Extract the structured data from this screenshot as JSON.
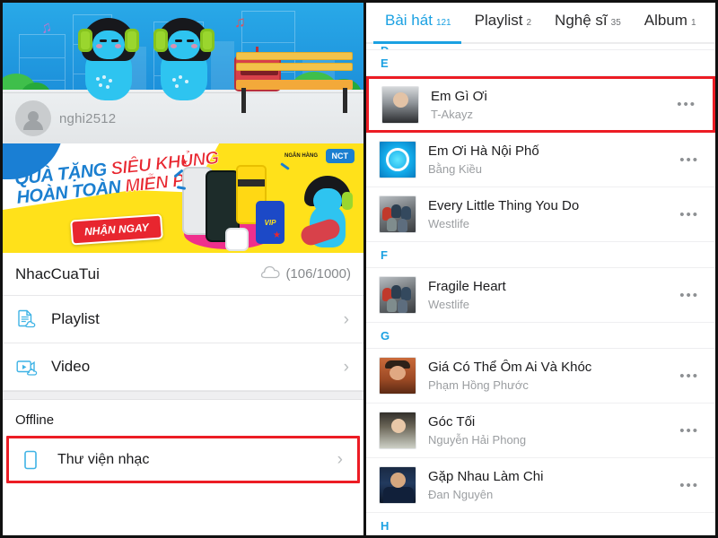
{
  "left": {
    "hero": {
      "username": "nghi2512",
      "avatar_icon": "user-avatar-icon"
    },
    "promo": {
      "line1_a": "QUÀ TẶNG ",
      "line1_b": "SIÊU KHỦNG",
      "line2_a": "HOÀN TOÀN ",
      "line2_b": "MIỄN PHÍ",
      "cta": "NHẬN NGAY",
      "logo_left": "NGÂN HÀNG",
      "logo_right": "NCT",
      "vip_text": "VIP"
    },
    "account": {
      "name": "NhacCuaTui",
      "cloud_icon": "cloud-icon",
      "quota": "(106/1000)"
    },
    "menu": [
      {
        "label": "Playlist",
        "icon": "playlist-cloud-icon",
        "chevron": "›"
      },
      {
        "label": "Video",
        "icon": "video-cloud-icon",
        "chevron": "›"
      }
    ],
    "offline": {
      "header": "Offline",
      "item": {
        "label": "Thư viện nhạc",
        "icon": "phone-icon",
        "chevron": "›"
      }
    }
  },
  "right": {
    "tabs": [
      {
        "label": "Bài hát",
        "count": "121",
        "active": true
      },
      {
        "label": "Playlist",
        "count": "2",
        "active": false
      },
      {
        "label": "Nghệ sĩ",
        "count": "35",
        "active": false
      },
      {
        "label": "Album",
        "count": "1",
        "active": false
      }
    ],
    "partial_top_letter": "D",
    "sections": [
      {
        "letter": "E",
        "songs": [
          {
            "title": "Em Gì Ơi",
            "artist": "T-Akayz",
            "art": "th-man1",
            "highlighted": true,
            "menu": "•••"
          },
          {
            "title": "Em Ơi Hà Nội Phố",
            "artist": "Bằng Kiều",
            "art": "th-blue",
            "highlighted": false,
            "menu": "•••"
          },
          {
            "title": "Every Little Thing You Do",
            "artist": "Westlife",
            "art": "th-group",
            "highlighted": false,
            "menu": "•••"
          }
        ]
      },
      {
        "letter": "F",
        "songs": [
          {
            "title": "Fragile Heart",
            "artist": "Westlife",
            "art": "th-group",
            "highlighted": false,
            "menu": "•••"
          }
        ]
      },
      {
        "letter": "G",
        "songs": [
          {
            "title": "Giá Có Thể Ôm Ai Và Khóc",
            "artist": "Phạm Hồng Phước",
            "art": "th-orange",
            "highlighted": false,
            "menu": "•••"
          },
          {
            "title": "Góc Tối",
            "artist": "Nguyễn Hải Phong",
            "art": "th-pale",
            "highlighted": false,
            "menu": "•••"
          },
          {
            "title": "Gặp Nhau Làm Chi",
            "artist": "Đan Nguyên",
            "art": "th-dark",
            "highlighted": false,
            "menu": "•••"
          }
        ]
      },
      {
        "letter": "H",
        "songs": []
      }
    ]
  },
  "colors": {
    "accent_blue": "#1ba1e2",
    "highlight_red": "#ec1c24",
    "promo_yellow": "#ffe11a",
    "text_primary": "#1b1b1d",
    "text_secondary": "#9b9ea1"
  }
}
